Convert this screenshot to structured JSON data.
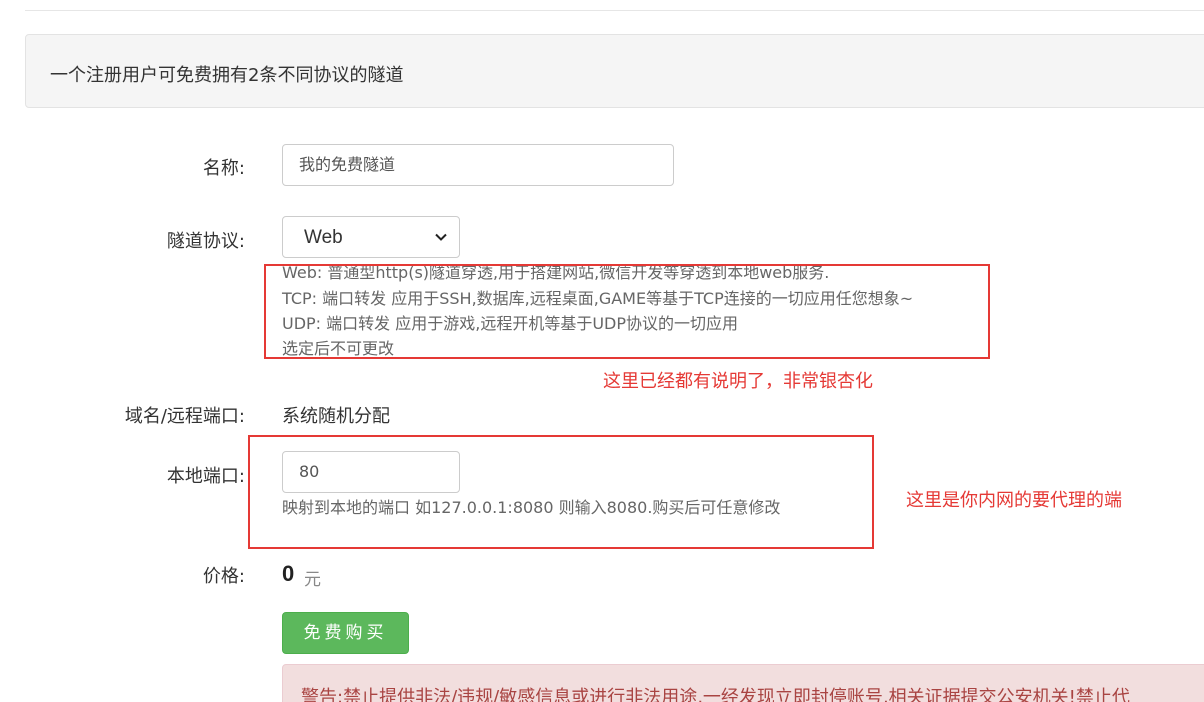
{
  "notice": {
    "text": "一个注册用户可免费拥有2条不同协议的隧道"
  },
  "form": {
    "name": {
      "label": "名称:",
      "value": "我的免费隧道"
    },
    "protocol": {
      "label": "隧道协议:",
      "selected": "Web",
      "help": [
        "Web: 普通型http(s)隧道穿透,用于搭建网站,微信开发等穿透到本地web服务.",
        "TCP: 端口转发 应用于SSH,数据库,远程桌面,GAME等基于TCP连接的一切应用任您想象~",
        "UDP: 端口转发 应用于游戏,远程开机等基于UDP协议的一切应用",
        "选定后不可更改"
      ]
    },
    "domain": {
      "label": "域名/远程端口:",
      "value": "系统随机分配"
    },
    "local_port": {
      "label": "本地端口:",
      "value": "80",
      "help": "映射到本地的端口 如127.0.0.1:8080 则输入8080.购买后可任意修改"
    },
    "price": {
      "label": "价格:",
      "amount": "0",
      "unit": "元"
    },
    "buy_button": "免费购买",
    "warning": "警告:禁止提供非法/违规/敏感信息或进行非法用途,一经发现立即封停账号,相关证据提交公安机关!禁止代"
  },
  "annotations": {
    "protocol_note": "这里已经都有说明了，非常银杏化",
    "port_note": "这里是你内网的要代理的端"
  },
  "colors": {
    "annotation": "#e53935",
    "button": "#5cb85c",
    "warning_bg": "#f2dede",
    "warning_text": "#a94442"
  }
}
